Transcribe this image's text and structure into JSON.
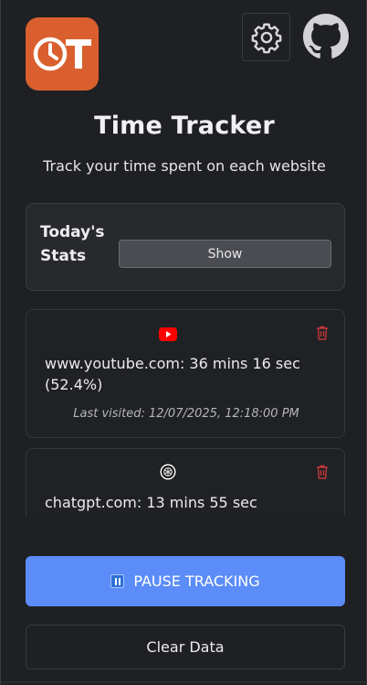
{
  "header": {
    "logo_text": "OT",
    "settings_icon": "gear-icon",
    "github_icon": "github-icon"
  },
  "title": "Time Tracker",
  "subtitle": "Track your time spent on each website",
  "stats": {
    "label": "Today's Stats",
    "show_button": "Show"
  },
  "sites": [
    {
      "domain": "www.youtube.com",
      "text": "www.youtube.com: 36 mins 16 sec (52.4%)",
      "last_visited": "Last visited: 12/07/2025, 12:18:00 PM",
      "icon": "youtube-icon",
      "color": "#ff0000"
    },
    {
      "domain": "chatgpt.com",
      "text": "chatgpt.com: 13 mins 55 sec",
      "icon": "chatgpt-icon",
      "color": "#000000"
    }
  ],
  "actions": {
    "pause_label": "PAUSE TRACKING",
    "clear_label": "Clear Data"
  },
  "colors": {
    "accent": "#5b8cf7",
    "logo": "#d9602e",
    "delete": "#c0393b"
  }
}
